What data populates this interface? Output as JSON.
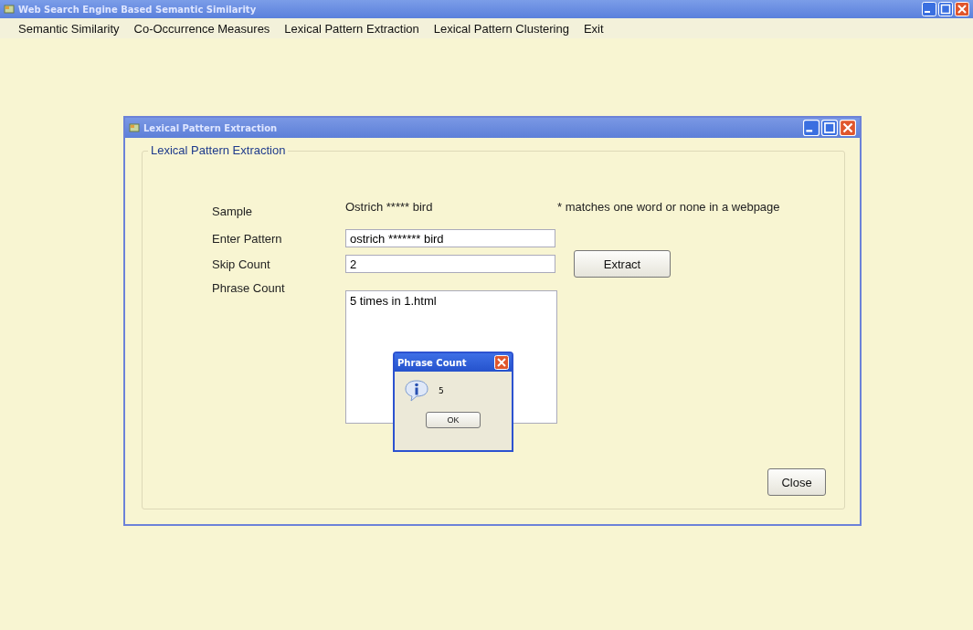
{
  "window": {
    "title": "Web Search Engine Based Semantic Similarity"
  },
  "menu": [
    "Semantic Similarity",
    "Co-Occurrence Measures",
    "Lexical Pattern Extraction",
    "Lexical Pattern Clustering",
    "Exit"
  ],
  "dialog": {
    "title": "Lexical Pattern Extraction",
    "group_title": "Lexical Pattern Extraction",
    "sample_label": "Sample",
    "sample_value": "Ostrich ***** bird",
    "sample_note": "* matches one word or none in a webpage",
    "pattern_label": "Enter Pattern",
    "pattern_value": "ostrich ******* bird",
    "skip_label": "Skip Count",
    "skip_value": "2",
    "extract_button": "Extract",
    "phrase_label": "Phrase Count",
    "phrase_value": "5 times in 1.html",
    "close_button": "Close"
  },
  "message_box": {
    "title": "Phrase Count",
    "message": "5",
    "ok_button": "OK"
  }
}
